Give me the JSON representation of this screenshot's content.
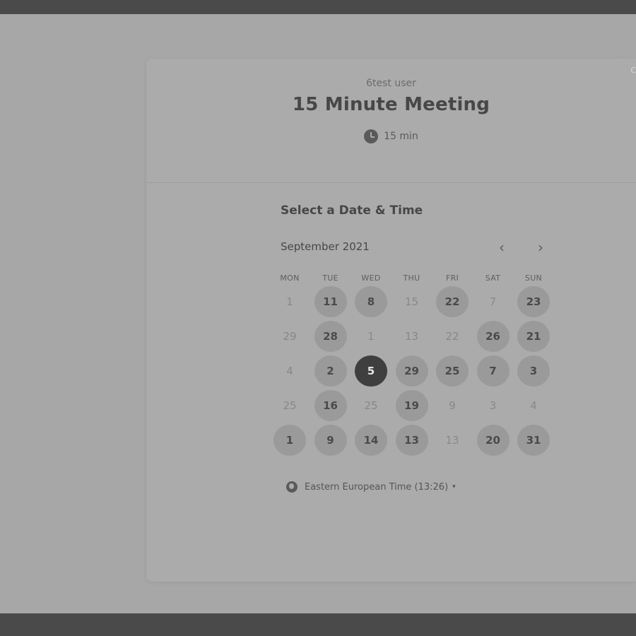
{
  "badge": {
    "text": "C"
  },
  "header": {
    "org_name": "6test user",
    "title": "15 Minute Meeting",
    "duration": "15 min",
    "duration_icon": "clock-icon"
  },
  "calendar": {
    "heading": "Select a Date & Time",
    "month": "September 2021",
    "prev_label": "‹",
    "next_label": "›",
    "weekdays": [
      "MON",
      "TUE",
      "WED",
      "THU",
      "FRI",
      "SAT",
      "SUN"
    ],
    "weeks": [
      [
        {
          "d": "1",
          "s": "off"
        },
        {
          "d": "11",
          "s": "avail"
        },
        {
          "d": "8",
          "s": "avail"
        },
        {
          "d": "15",
          "s": "off"
        },
        {
          "d": "22",
          "s": "avail"
        },
        {
          "d": "7",
          "s": "off"
        },
        {
          "d": "23",
          "s": "avail"
        }
      ],
      [
        {
          "d": "29",
          "s": "off"
        },
        {
          "d": "28",
          "s": "avail"
        },
        {
          "d": "1",
          "s": "off"
        },
        {
          "d": "13",
          "s": "off"
        },
        {
          "d": "22",
          "s": "off"
        },
        {
          "d": "26",
          "s": "avail"
        },
        {
          "d": "21",
          "s": "avail"
        }
      ],
      [
        {
          "d": "4",
          "s": "off"
        },
        {
          "d": "2",
          "s": "avail"
        },
        {
          "d": "5",
          "s": "selected"
        },
        {
          "d": "29",
          "s": "avail"
        },
        {
          "d": "25",
          "s": "avail"
        },
        {
          "d": "7",
          "s": "avail"
        },
        {
          "d": "3",
          "s": "avail"
        }
      ],
      [
        {
          "d": "25",
          "s": "off"
        },
        {
          "d": "16",
          "s": "avail"
        },
        {
          "d": "25",
          "s": "off"
        },
        {
          "d": "19",
          "s": "avail"
        },
        {
          "d": "9",
          "s": "off"
        },
        {
          "d": "3",
          "s": "off"
        },
        {
          "d": "4",
          "s": "off"
        }
      ],
      [
        {
          "d": "1",
          "s": "avail"
        },
        {
          "d": "9",
          "s": "avail"
        },
        {
          "d": "14",
          "s": "avail"
        },
        {
          "d": "13",
          "s": "avail"
        },
        {
          "d": "13",
          "s": "off"
        },
        {
          "d": "20",
          "s": "avail"
        },
        {
          "d": "31",
          "s": "avail"
        }
      ]
    ]
  },
  "timezone": {
    "label": "Eastern European Time (13:26)",
    "caret": "▾",
    "icon": "globe-icon"
  }
}
